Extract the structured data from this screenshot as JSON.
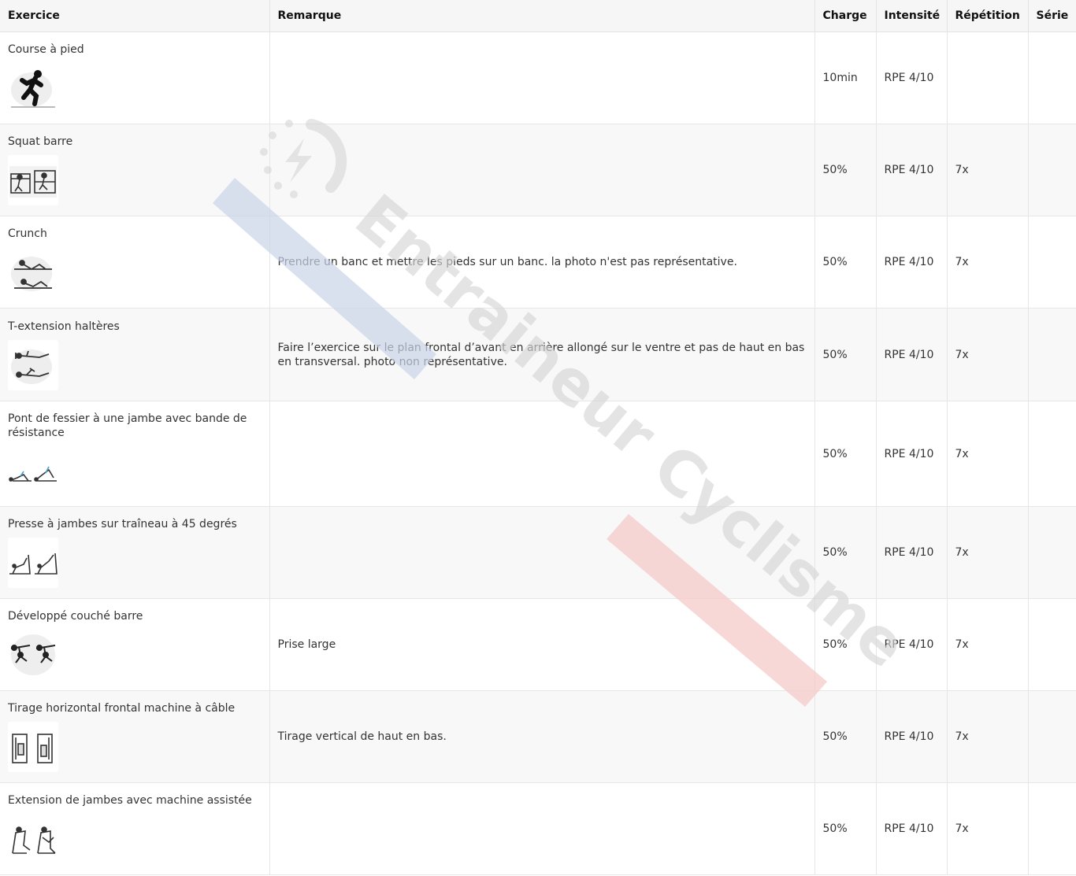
{
  "table": {
    "headers": {
      "exercise": "Exercice",
      "remark": "Remarque",
      "load": "Charge",
      "intensity": "Intensité",
      "repetition": "Répétition",
      "series": "Série"
    },
    "rows": [
      {
        "exercise": "Course à pied",
        "icon": "running-figure-icon",
        "remark": "",
        "load": "10min",
        "intensity": "RPE 4/10",
        "repetition": "",
        "series": ""
      },
      {
        "exercise": "Squat barre",
        "icon": "barbell-squat-icon",
        "remark": "",
        "load": "50%",
        "intensity": "RPE 4/10",
        "repetition": "7x",
        "series": ""
      },
      {
        "exercise": "Crunch",
        "icon": "crunch-icon",
        "remark": "Prendre un banc et mettre les pieds sur un banc. la photo n'est pas représentative.",
        "load": "50%",
        "intensity": "RPE 4/10",
        "repetition": "7x",
        "series": ""
      },
      {
        "exercise": "T-extension haltères",
        "icon": "dumbbell-extension-icon",
        "remark": "Faire l’exercice sur le plan frontal d’avant en arrière allongé sur le ventre et pas de haut en bas en transversal. photo non représentative.",
        "load": "50%",
        "intensity": "RPE 4/10",
        "repetition": "7x",
        "series": ""
      },
      {
        "exercise": "Pont de fessier à une jambe avec bande de résistance",
        "icon": "glute-bridge-icon",
        "remark": "",
        "load": "50%",
        "intensity": "RPE 4/10",
        "repetition": "7x",
        "series": ""
      },
      {
        "exercise": "Presse à jambes sur traîneau à 45 degrés",
        "icon": "leg-press-icon",
        "remark": "",
        "load": "50%",
        "intensity": "RPE 4/10",
        "repetition": "7x",
        "series": ""
      },
      {
        "exercise": "Développé couché barre",
        "icon": "bench-press-icon",
        "remark": "Prise large",
        "load": "50%",
        "intensity": "RPE 4/10",
        "repetition": "7x",
        "series": ""
      },
      {
        "exercise": "Tirage horizontal frontal machine à câble",
        "icon": "cable-row-machine-icon",
        "remark": "Tirage vertical de haut en bas.",
        "load": "50%",
        "intensity": "RPE 4/10",
        "repetition": "7x",
        "series": ""
      },
      {
        "exercise": "Extension de jambes avec machine assistée",
        "icon": "leg-extension-machine-icon",
        "remark": "",
        "load": "50%",
        "intensity": "RPE 4/10",
        "repetition": "7x",
        "series": ""
      }
    ]
  },
  "watermark": {
    "text": "Entraineur Cyclisme",
    "icon": "lightning-circle-icon",
    "colors": {
      "text": "#d9d9d9",
      "blue_stripe": "#c9d4e8",
      "red_stripe": "#f6c9c9"
    }
  }
}
